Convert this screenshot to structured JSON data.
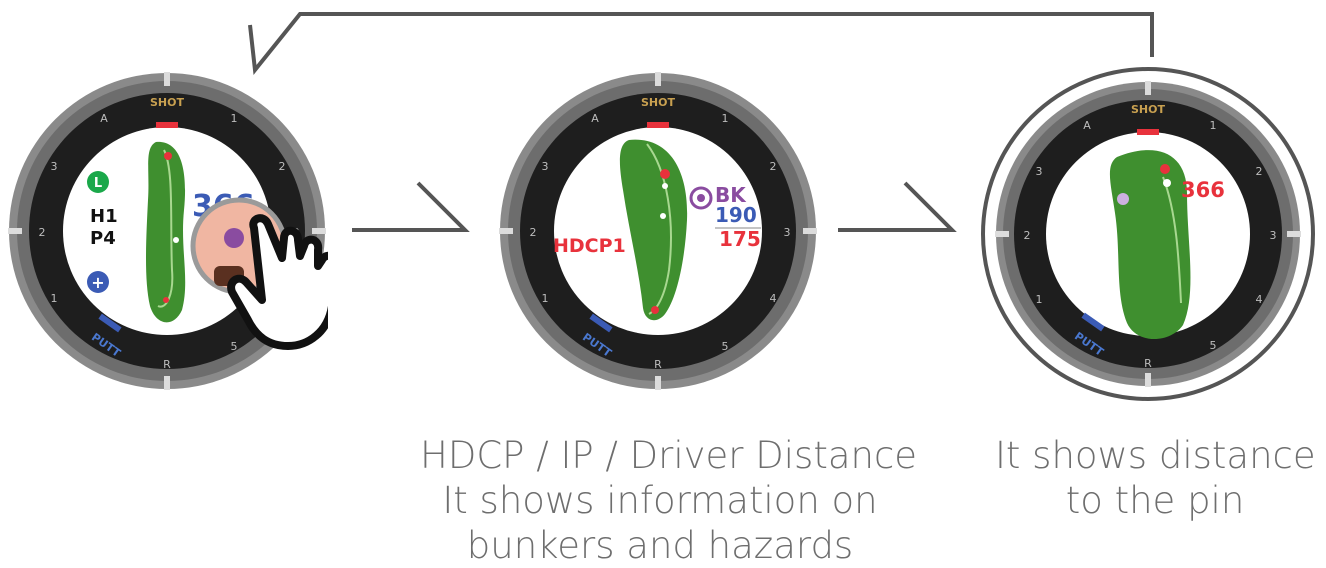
{
  "bezel": {
    "top_label": "SHOT",
    "bottom_left_label": "PUTT",
    "ring_marks": [
      "A",
      "1",
      "2",
      "3",
      "4",
      "5",
      "R",
      "1",
      "2",
      "3"
    ]
  },
  "watch1": {
    "hole_label": "H1",
    "par_label": "P4",
    "distance_partial": "366",
    "cart_icon_letter": "L"
  },
  "watch2": {
    "hdcp_label": "HDCP1",
    "bunker_label": "BK",
    "bunker_distance": "190",
    "hazard_distance": "175"
  },
  "watch3": {
    "pin_distance": "366"
  },
  "captions": {
    "middle": [
      "HDCP / IP / Driver Distance",
      "It shows information on",
      "bunkers and hazards"
    ],
    "right": [
      "It shows distance",
      "to the pin"
    ]
  },
  "colors": {
    "bezel_outer": "#8a8a8a",
    "bezel_ring": "#1e1e1e",
    "accent_red": "#e8323c",
    "accent_blue": "#3b5bb5",
    "shot_gold": "#c8a050",
    "putt_blue": "#4a78d0",
    "fairway_green": "#3f8f2f",
    "bunker_purple": "#8a4ca0"
  }
}
